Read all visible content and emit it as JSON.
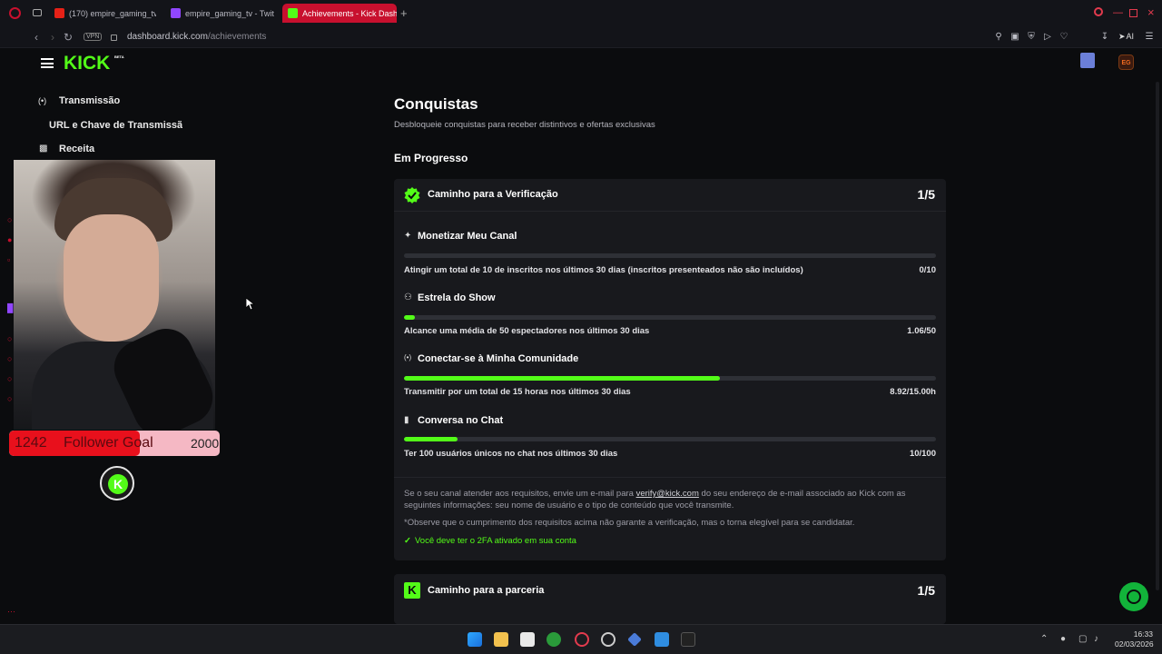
{
  "browser": {
    "tabs": [
      {
        "label": "(170) empire_gaming_tv -",
        "favicon_color": "#e62117"
      },
      {
        "label": "empire_gaming_tv - Twitc",
        "favicon_color": "#9146ff"
      },
      {
        "label": "Achievements - Kick Dash",
        "favicon_color": "#53fc18",
        "active": true
      }
    ],
    "vpn_label": "VPN",
    "url_host": "dashboard.kick.com",
    "url_path": "/achievements",
    "ai_label": "AI"
  },
  "kick": {
    "logo": "KICK",
    "logo_sup": "BETA",
    "user_badge": "EG",
    "sidebar": [
      {
        "label": "Transmissão",
        "icon": "broadcast-icon"
      },
      {
        "label": "URL e Chave de Transmissão",
        "icon": ""
      },
      {
        "label": "Receita",
        "icon": "bar-chart-icon"
      }
    ]
  },
  "overlay": {
    "goal_current": "1242",
    "goal_label": "Follower Goal",
    "goal_target": "2000",
    "goal_progress": 0.62,
    "goal_fill_color": "#e8101c",
    "goal_bg_color": "#f5b8c4"
  },
  "main": {
    "title": "Conquistas",
    "subtitle": "Desbloqueie conquistas para receber distintivos e ofertas exclusivas",
    "section": "Em Progresso",
    "accent": "#53fc18",
    "cards": [
      {
        "title": "Caminho para a Verificação",
        "count": "1/5",
        "icon": "verified-badge-icon",
        "achievements": [
          {
            "title": "Monetizar Meu Canal",
            "icon": "sparkle-icon",
            "desc": "Atingir um total de 10 de inscritos nos últimos 30 dias (inscritos presenteados não são incluídos)",
            "value": "0/10",
            "progress": 0
          },
          {
            "title": "Estrela do Show",
            "icon": "users-icon",
            "desc": "Alcance uma média de 50 espectadores nos últimos 30 dias",
            "value": "1.06/50",
            "progress": 0.0212
          },
          {
            "title": "Conectar-se à Minha Comunidade",
            "icon": "broadcast-icon",
            "desc": "Transmitir por um total de 15 horas nos últimos 30 dias",
            "value": "8.92/15.00h",
            "progress": 0.5947
          },
          {
            "title": "Conversa no Chat",
            "icon": "chat-icon",
            "desc": "Ter 100 usuários únicos no chat nos últimos 30 dias",
            "value": "10/100",
            "progress": 0.1
          }
        ],
        "note_before": "Se o seu canal atender aos requisitos, envie um e-mail para ",
        "note_email": "verify@kick.com",
        "note_after": " do seu endereço de e-mail associado ao Kick com as seguintes informações: seu nome de usuário e o tipo de conteúdo que você transmite.",
        "note2": "*Observe que o cumprimento dos requisitos acima não garante a verificação, mas o torna elegível para se candidatar.",
        "requirement": "Você deve ter o 2FA ativado em sua conta"
      },
      {
        "title": "Caminho para a parceria",
        "count": "1/5",
        "icon": "kick-logo-icon"
      }
    ]
  },
  "taskbar": {
    "time": "16:33",
    "date": "02/03/2026"
  }
}
